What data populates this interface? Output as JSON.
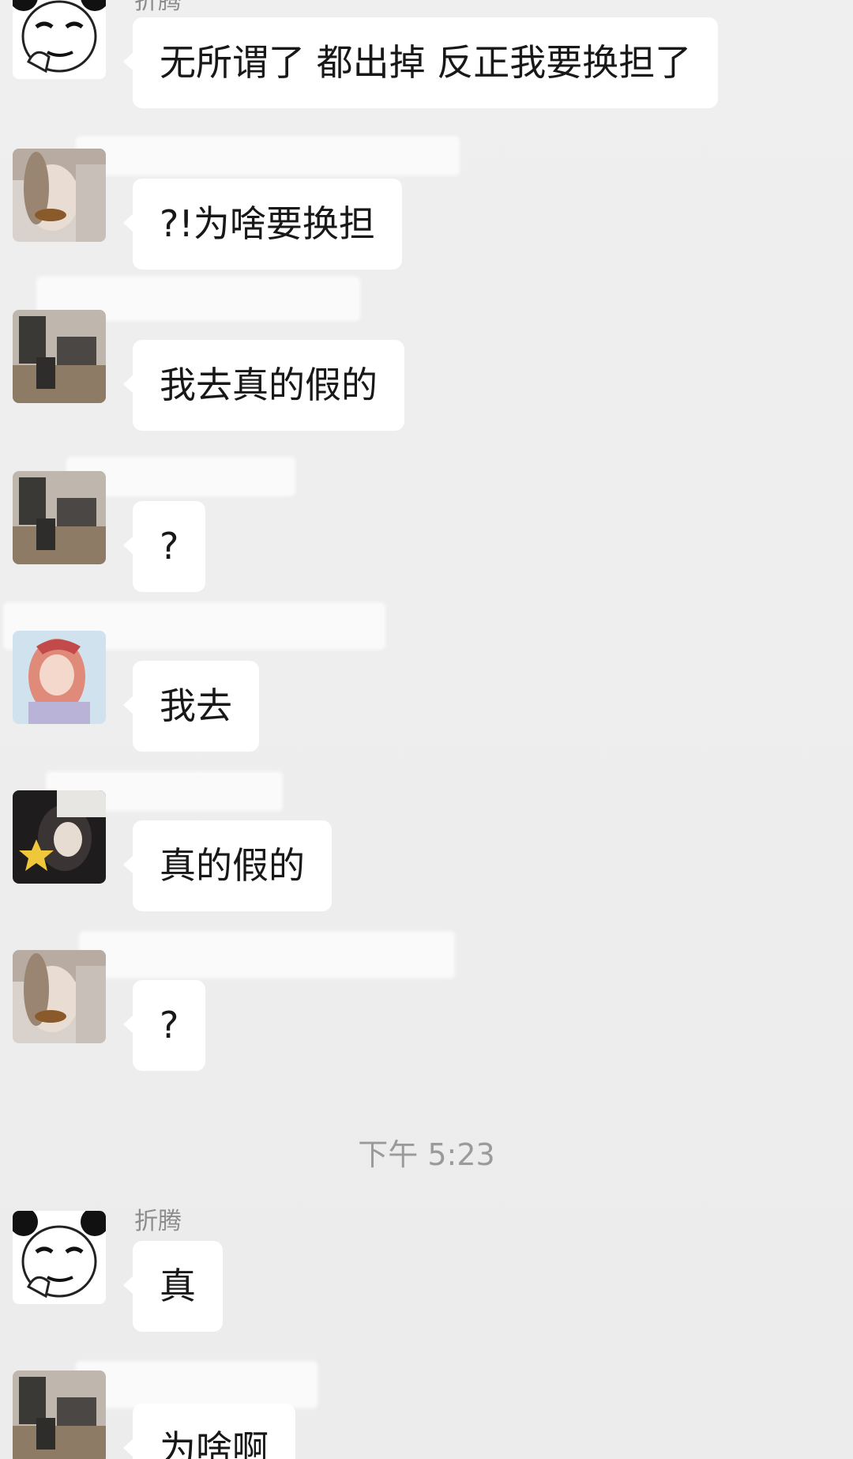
{
  "chat": {
    "timestamp": "下午 5:23",
    "messages": [
      {
        "sender": "折腾",
        "avatar_icon": "panda-meme-icon",
        "text": "无所谓了 都出掉 反正我要换担了",
        "bubble_color": "#ffffff"
      },
      {
        "sender": "",
        "avatar_icon": "selfie-photo-avatar-icon",
        "text": "?!为啥要换担",
        "bubble_color": "#ffffff"
      },
      {
        "sender": "",
        "avatar_icon": "room-photo-avatar-icon",
        "text": "我去真的假的",
        "bubble_color": "#ffffff"
      },
      {
        "sender": "",
        "avatar_icon": "room-photo-avatar-icon",
        "text": "?",
        "bubble_color": "#ffffff"
      },
      {
        "sender": "",
        "avatar_icon": "pink-hair-avatar-icon",
        "text": "我去",
        "bubble_color": "#ffffff"
      },
      {
        "sender": "",
        "avatar_icon": "star-photo-avatar-icon",
        "text": "真的假的",
        "bubble_color": "#ffffff"
      },
      {
        "sender": "",
        "avatar_icon": "selfie-photo-avatar-icon",
        "text": "?",
        "bubble_color": "#ffffff"
      },
      {
        "sender": "折腾",
        "avatar_icon": "panda-meme-icon",
        "text": "真",
        "bubble_color": "#ffffff"
      },
      {
        "sender": "",
        "avatar_icon": "room-photo-avatar-icon",
        "text": "为啥啊",
        "bubble_color": "#ffffff"
      }
    ]
  },
  "colors": {
    "background": "#ededed",
    "bubble": "#ffffff",
    "text": "#181818",
    "meta_text": "#9a9a9a"
  }
}
